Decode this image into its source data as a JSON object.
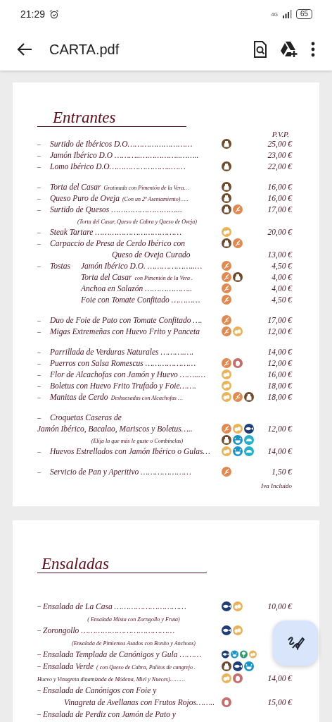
{
  "status_bar": {
    "time": "21:29",
    "network": "4G",
    "battery": "65"
  },
  "app_bar": {
    "title": "CARTA.pdf"
  },
  "pages": [
    {
      "heading": "Entrantes",
      "price_header": "P.V.P.",
      "footer": "Iva Incluido",
      "groups": [
        [
          {
            "kind": "item",
            "dash": "–",
            "label": "Surtido de Ibéricos D.O………………………",
            "icons": [
              {
                "kind": "dairy"
              }
            ],
            "price": "25,00 €"
          },
          {
            "kind": "item",
            "dash": "–",
            "label": "Jamón Ibérico D.O ………..……………..……..",
            "price": "23,00 €"
          },
          {
            "kind": "item",
            "dash": "–",
            "label": "Lomo Ibérico D.O……………………..……",
            "icons": [
              {
                "kind": "dairy"
              }
            ],
            "price": "22,00 €"
          }
        ],
        [
          {
            "kind": "item",
            "dash": "–",
            "label": "Torta del Casar",
            "note": "Gratinada con Pimentón de la Vera…",
            "icons": [
              {
                "kind": "dairy"
              }
            ],
            "price": "16,00 €"
          },
          {
            "kind": "item",
            "dash": "–",
            "label": "Queso Puro de Oveja",
            "note": "(Con un 2º Asentamiento)…..",
            "icons": [
              {
                "kind": "dairy"
              }
            ],
            "price": "16,00 €"
          },
          {
            "kind": "item",
            "dash": "–",
            "label": "Surtido de Quesos ………………………...",
            "icons": [
              {
                "kind": "dairy"
              },
              {
                "kind": "gluten"
              }
            ],
            "price": "17,00 €"
          },
          {
            "kind": "subline",
            "note": "(Torta del Casar, Queso de Cabra y Queso de Oveja)"
          },
          {
            "kind": "item",
            "dash": "–",
            "label": "Steak Tartare ………………………………",
            "icons": [
              {
                "kind": "egg"
              }
            ],
            "price": "20,00 €"
          },
          {
            "kind": "item",
            "dash": "–",
            "label": "Carpaccio de Presa de Cerdo Ibérico con",
            "icons": [
              {
                "kind": "dairy"
              },
              {
                "kind": "gluten"
              }
            ]
          },
          {
            "kind": "continuation",
            "label": "Queso de Oveja Curado",
            "price": "13,00 €"
          },
          {
            "kind": "tosta",
            "dash": "–",
            "lead": "Tostas",
            "label": "Jamón Ibérico D.O. ………………..…",
            "icons": [
              {
                "kind": "gluten"
              }
            ],
            "price": "4,50 €"
          },
          {
            "kind": "tosta",
            "label": "Torta del Casar",
            "note": "con Pimentón de la Vera .",
            "icons": [
              {
                "kind": "gluten"
              },
              {
                "kind": "dairy"
              }
            ],
            "price": "4,00 €"
          },
          {
            "kind": "tosta",
            "label": "Anchoa en Salazón ………………..",
            "icons": [
              {
                "kind": "gluten"
              }
            ],
            "price": "4,00 €"
          },
          {
            "kind": "tosta",
            "label": "Foie con Tomate Confitado …………",
            "icons": [
              {
                "kind": "gluten"
              }
            ],
            "price": "4,50 €"
          }
        ],
        [
          {
            "kind": "item",
            "dash": "–",
            "label": "Duo de Foie de Pato con Tomate Confitado ….",
            "icons": [
              {
                "kind": "gluten"
              }
            ],
            "price": "17,00 €"
          },
          {
            "kind": "item",
            "dash": "–",
            "label": "Migas Extremeñas con Huevo Frito y Panceta",
            "icons": [
              {
                "kind": "gluten"
              },
              {
                "kind": "egg"
              }
            ],
            "price": "12,00 €"
          }
        ],
        [
          {
            "kind": "item",
            "dash": "–",
            "label": "Parrillada de Verduras Naturales ……….….",
            "price": "14,00 €"
          },
          {
            "kind": "item",
            "dash": "–",
            "label": "Puerros con Salsa Romescus …………………",
            "icons": [
              {
                "kind": "gluten"
              },
              {
                "kind": "nuts"
              }
            ],
            "price": "12,00 €"
          },
          {
            "kind": "item",
            "dash": "–",
            "label": "Flor de Alcachofas con Jamón y Huevo ……..…",
            "icons": [
              {
                "kind": "egg"
              }
            ],
            "price": "16,00 €"
          },
          {
            "kind": "item",
            "dash": "–",
            "label": "Boletus con Huevo Frito Trufado y Foie…….",
            "icons": [
              {
                "kind": "egg"
              }
            ],
            "price": "18,00 €"
          },
          {
            "kind": "item",
            "dash": "–",
            "label": "Manitas de Cerdo",
            "note": "Deshuesadas con Alcachofas …",
            "icons": [
              {
                "kind": "egg"
              },
              {
                "kind": "gluten"
              },
              {
                "kind": "dairy"
              }
            ],
            "price": "18,00 €"
          }
        ],
        [
          {
            "kind": "item",
            "dash": "–",
            "label": "Croquetas Caseras de"
          },
          {
            "kind": "plain",
            "label": "Jamón Ibérico, Bacalao, Mariscos y Boletus…..",
            "icons": [
              {
                "kind": "gluten"
              },
              {
                "kind": "egg"
              },
              {
                "kind": "fish"
              }
            ],
            "price": "12,00 €"
          },
          {
            "kind": "subline",
            "note": "(Elija la que más le guste o Combínelas)",
            "icons": [
              {
                "kind": "dairy"
              },
              {
                "kind": "crustacean"
              },
              {
                "kind": "mollusc"
              }
            ]
          },
          {
            "kind": "item",
            "dash": "–",
            "label": "Huevos Estrellados con Jamón Ibérico o Gulas…",
            "icons": [
              {
                "kind": "egg"
              },
              {
                "kind": "crustacean"
              },
              {
                "kind": "mollusc"
              }
            ],
            "price": "14,00 €"
          }
        ],
        [
          {
            "kind": "item",
            "dash": "–",
            "label": "Servicio de Pan y Aperitivo …………………",
            "icons": [
              {
                "kind": "gluten"
              }
            ],
            "price": "1,50 €"
          }
        ]
      ]
    },
    {
      "heading": "Ensaladas",
      "groups": [
        [
          {
            "kind": "item",
            "dash": "–",
            "label": "Ensalada de La Casa …………………………",
            "icons": [
              {
                "kind": "fish"
              },
              {
                "kind": "egg"
              }
            ],
            "price": "10,00 €"
          },
          {
            "kind": "subline",
            "note": "( Ensalada Mixta con Zorngollo y Fruta)"
          },
          {
            "kind": "item",
            "dash": "–",
            "label": "Zorongollo …………………………………",
            "icons": [
              {
                "kind": "fish"
              },
              {
                "kind": "egg"
              }
            ]
          },
          {
            "kind": "subline",
            "note": "(Ensalada de Pimientos Asados con Bonito y Anchoas)"
          },
          {
            "kind": "item",
            "dash": "–",
            "label": "Ensalada Templada de Canónigos y Gula ………",
            "icons": [
              {
                "kind": "fish"
              },
              {
                "kind": "crustacean"
              },
              {
                "kind": "celery"
              },
              {
                "kind": "egg"
              }
            ]
          },
          {
            "kind": "item",
            "dash": "–",
            "label": "Ensalada Verde",
            "note": "( con Queso de Cabra, Palitos de cangrejo .",
            "icons": [
              {
                "kind": "dairy"
              },
              {
                "kind": "fish"
              },
              {
                "kind": "crustacean"
              }
            ]
          },
          {
            "kind": "plainsmall",
            "label": "Huevo y Vinagreta dinamizada de Módena, Miel y Nueces)………",
            "icons": [
              {
                "kind": "egg"
              },
              {
                "kind": "nuts"
              }
            ],
            "price": "14,00 €"
          },
          {
            "kind": "item",
            "dash": "–",
            "label": "Ensalada de Canónigos con Foie  y"
          },
          {
            "kind": "continuation",
            "label": "Vinagreta de Avellanas con Frutos Rojos……..",
            "icons": [
              {
                "kind": "nuts"
              }
            ],
            "price": "15,00 €"
          },
          {
            "kind": "item",
            "dash": "–",
            "label": "Ensalada de Perdiz con Jamón de Pato y"
          }
        ]
      ]
    }
  ]
}
